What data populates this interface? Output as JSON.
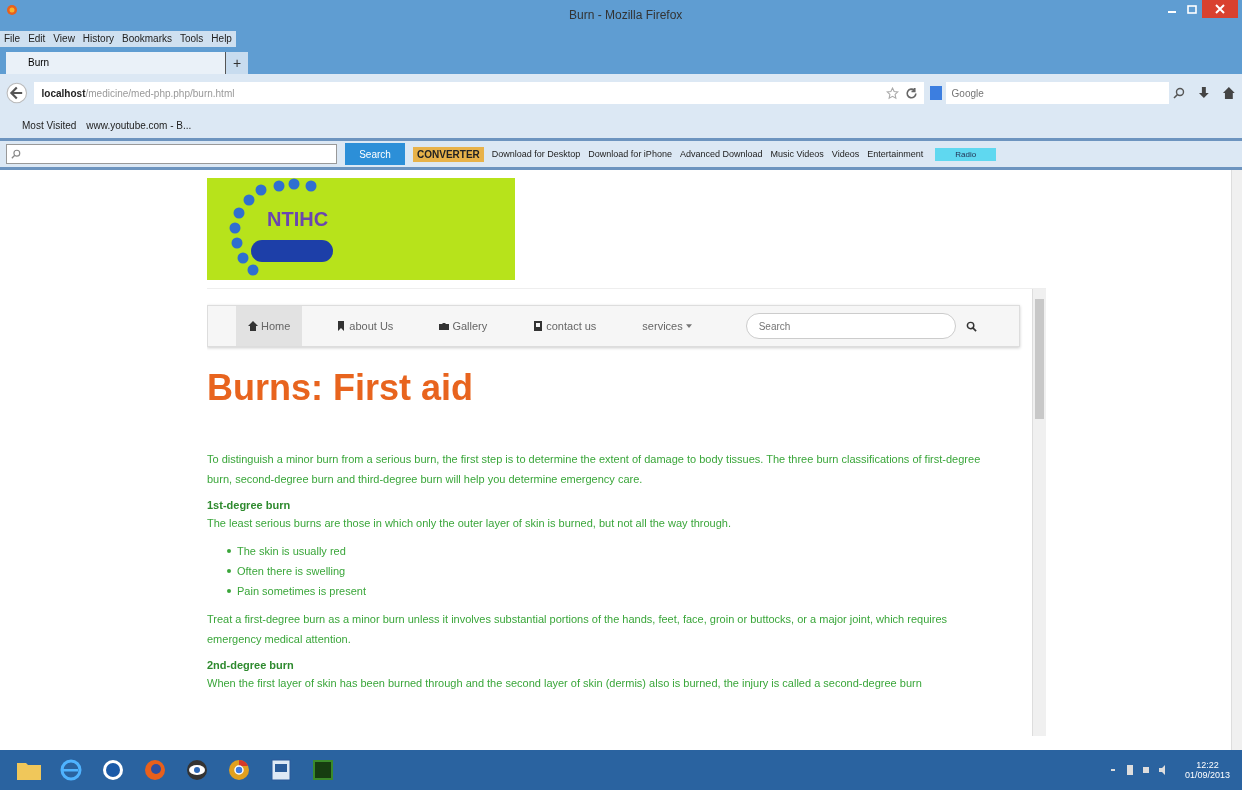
{
  "window": {
    "title": "Burn - Mozilla Firefox"
  },
  "menu": [
    "File",
    "Edit",
    "View",
    "History",
    "Bookmarks",
    "Tools",
    "Help"
  ],
  "tabs": [
    {
      "label": "Burn",
      "selected": true
    }
  ],
  "new_tab": "+",
  "address": {
    "host": "localhost",
    "path": "/medicine/med-php.php/burn.html"
  },
  "web_search": {
    "placeholder": "Google"
  },
  "bookmarks": [
    {
      "label": "Most Visited"
    },
    {
      "label": "www.youtube.com - B..."
    }
  ],
  "toolbar": {
    "search_button": "Search",
    "logo": "CONVERTER",
    "links": [
      "Download for Desktop",
      "Download for iPhone",
      "Advanced Download",
      "Music Videos",
      "Videos",
      "Entertainment"
    ],
    "radio": "Radio"
  },
  "page": {
    "logo": "NTIHC",
    "nav": [
      {
        "label": "Home",
        "kind": "home",
        "selected": true
      },
      {
        "label": "about Us",
        "kind": "bookmark",
        "selected": false
      },
      {
        "label": "Gallery",
        "kind": "camera",
        "selected": false
      },
      {
        "label": "contact us",
        "kind": "contact",
        "selected": false
      },
      {
        "label": "services",
        "kind": "menu",
        "selected": false
      }
    ],
    "search": {
      "placeholder": "Search"
    },
    "heading": "Burns: First aid",
    "blocks": [
      {
        "kind": "paragraph",
        "text": "To distinguish a minor burn from a serious burn, the first step is to determine the extent of damage to body tissues. The three burn classifications of first-degree burn, second-degree burn and third-degree burn will help you determine emergency care."
      },
      {
        "kind": "subheading",
        "text": "1st-degree burn"
      },
      {
        "kind": "paragraph",
        "text": "The least serious burns are those in which only the outer layer of skin is burned, but not all the way through."
      },
      {
        "kind": "list",
        "items": [
          "The skin is usually red",
          "Often there is swelling",
          "Pain sometimes is present"
        ]
      },
      {
        "kind": "paragraph",
        "text": "Treat a first-degree burn as a minor burn unless it involves substantial portions of the hands, feet, face, groin or buttocks, or a major joint, which requires emergency medical attention."
      },
      {
        "kind": "subheading",
        "text": "2nd-degree burn"
      },
      {
        "kind": "paragraph",
        "text": "When the first layer of skin has been burned through and the second layer of skin (dermis) also is burned, the injury is called a second-degree burn"
      }
    ]
  },
  "taskbar": {
    "time": "12:22",
    "date": "01/09/2013"
  }
}
